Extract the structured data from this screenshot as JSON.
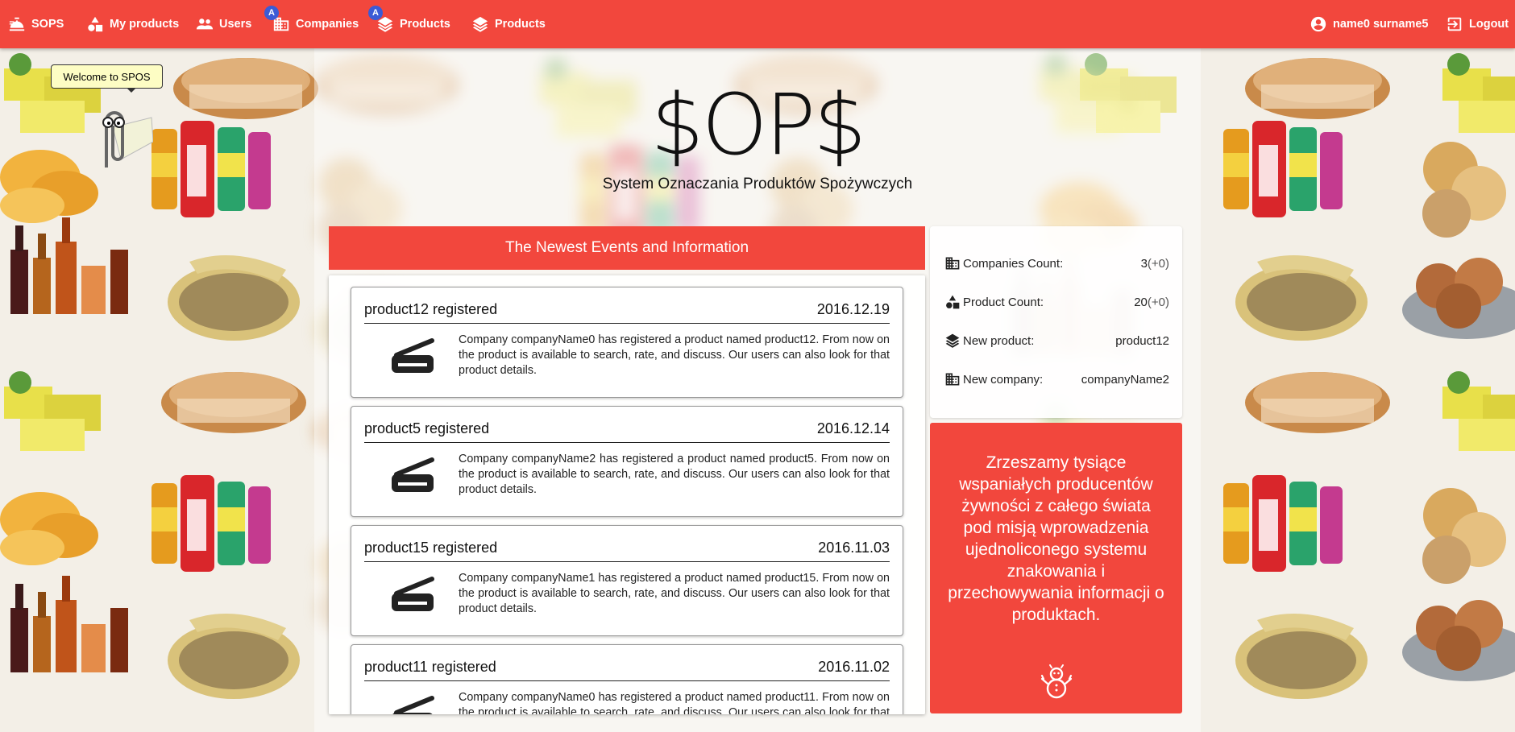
{
  "nav": {
    "brand": "SOPS",
    "items": [
      {
        "label": "My products",
        "icon": "shapes-icon",
        "badge": ""
      },
      {
        "label": "Users",
        "icon": "users-icon",
        "badge": ""
      },
      {
        "label": "Companies",
        "icon": "building-icon",
        "badge": "A"
      },
      {
        "label": "Products",
        "icon": "layers-icon",
        "badge": "A"
      },
      {
        "label": "Products",
        "icon": "layers-icon",
        "badge": ""
      }
    ],
    "user": "name0 surname5",
    "logout": "Logout"
  },
  "assistant": {
    "bubble": "Welcome to SPOS",
    "icon": "paperclip-assistant-icon"
  },
  "hero": {
    "title": "$OP$",
    "subtitle": "System Oznaczania Produktów Spożywczych"
  },
  "events": {
    "header": "The Newest Events and Information",
    "items": [
      {
        "title": "product12 registered",
        "date": "2016.12.19",
        "icon": "barcode-scanner-icon",
        "text": "Company companyName0 has registered a product named product12. From now on the product is available to search, rate, and discuss. Our users can also look for that product details."
      },
      {
        "title": "product5 registered",
        "date": "2016.12.14",
        "icon": "barcode-scanner-icon",
        "text": "Company companyName2 has registered a product named product5. From now on the product is available to search, rate, and discuss. Our users can also look for that product details."
      },
      {
        "title": "product15 registered",
        "date": "2016.11.03",
        "icon": "barcode-scanner-icon",
        "text": "Company companyName1 has registered a product named product15. From now on the product is available to search, rate, and discuss. Our users can also look for that product details."
      },
      {
        "title": "product11 registered",
        "date": "2016.11.02",
        "icon": "barcode-scanner-icon",
        "text": "Company companyName0 has registered a product named product11. From now on the product is available to search, rate, and discuss. Our users can also look for that product details."
      }
    ]
  },
  "stats": [
    {
      "label": "Companies Count:",
      "value": "3",
      "delta": "(+0)",
      "icon": "building-icon"
    },
    {
      "label": "Product Count:",
      "value": "20",
      "delta": "(+0)",
      "icon": "shapes-icon"
    },
    {
      "label": "New product:",
      "value": "product12",
      "delta": "",
      "icon": "layers-icon"
    },
    {
      "label": "New company:",
      "value": "companyName2",
      "delta": "",
      "icon": "building-icon"
    }
  ],
  "promo": {
    "text": "Zrzeszamy tysiące wspaniałych producentów żywności z całego świata pod misją wprowadzenia ujednoliconego systemu znakowania i przechowywania informacji o produktach.",
    "icon": "snowman-icon"
  },
  "colors": {
    "accent": "#f2473d",
    "badge": "#3b5bd6",
    "assistant_bubble": "#fdfdc4"
  }
}
